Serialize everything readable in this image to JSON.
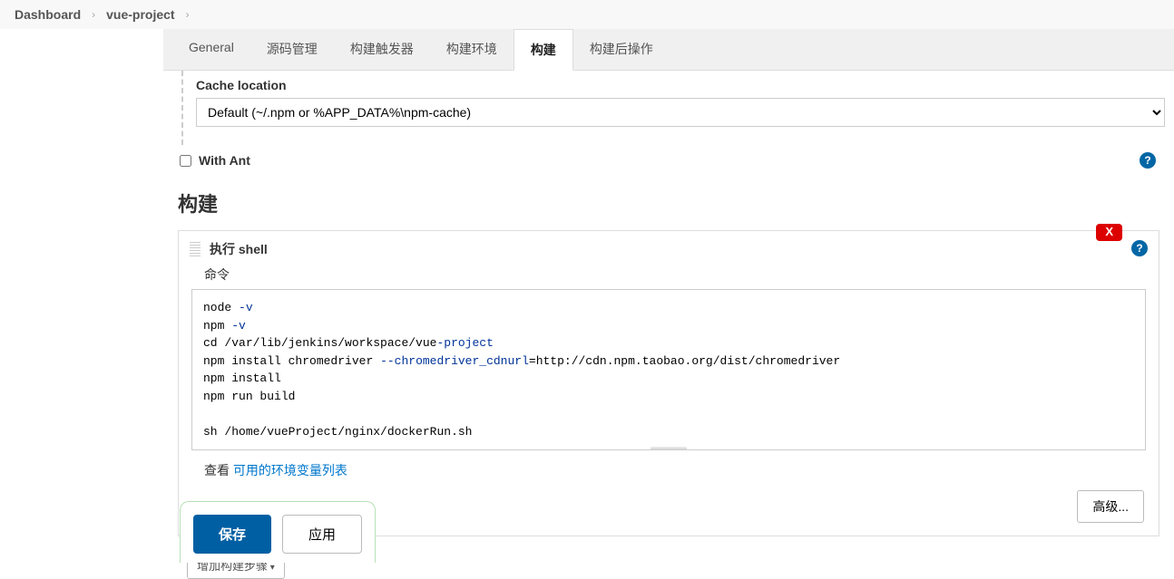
{
  "breadcrumb": {
    "home": "Dashboard",
    "project": "vue-project"
  },
  "tabs": {
    "general": "General",
    "scm": "源码管理",
    "trigger": "构建触发器",
    "env": "构建环境",
    "build": "构建",
    "post": "构建后操作"
  },
  "cache": {
    "label": "Cache location",
    "selected": "Default (~/.npm or %APP_DATA%\\npm-cache)"
  },
  "withAnt": {
    "label": "With Ant",
    "checked": false
  },
  "buildSection": {
    "title": "构建"
  },
  "shellStep": {
    "title": "执行 shell",
    "cmdLabel": "命令",
    "deleteLabel": "X",
    "code": {
      "l1a": "node",
      "l1b": "-v",
      "l2a": "npm",
      "l2b": "-v",
      "l3a": "cd",
      "l3b": "/var/lib/jenkins/workspace/vue",
      "l3c": "-project",
      "l4a": "npm",
      "l4b": "install chromedriver",
      "l4c": "--chromedriver_cdnurl",
      "l4d": "=http://cdn.npm.taobao.org/dist/chromedriver",
      "l5a": "npm",
      "l5b": "install",
      "l6a": "npm",
      "l6b": "run build",
      "l8a": "sh",
      "l8b": "/home/vueProject/nginx/dockerRun.sh"
    },
    "seePrefix": "查看 ",
    "seeLink": "可用的环境变量列表",
    "advanced": "高级..."
  },
  "addStep": "增加构建步骤",
  "save": "保存",
  "apply": "应用"
}
